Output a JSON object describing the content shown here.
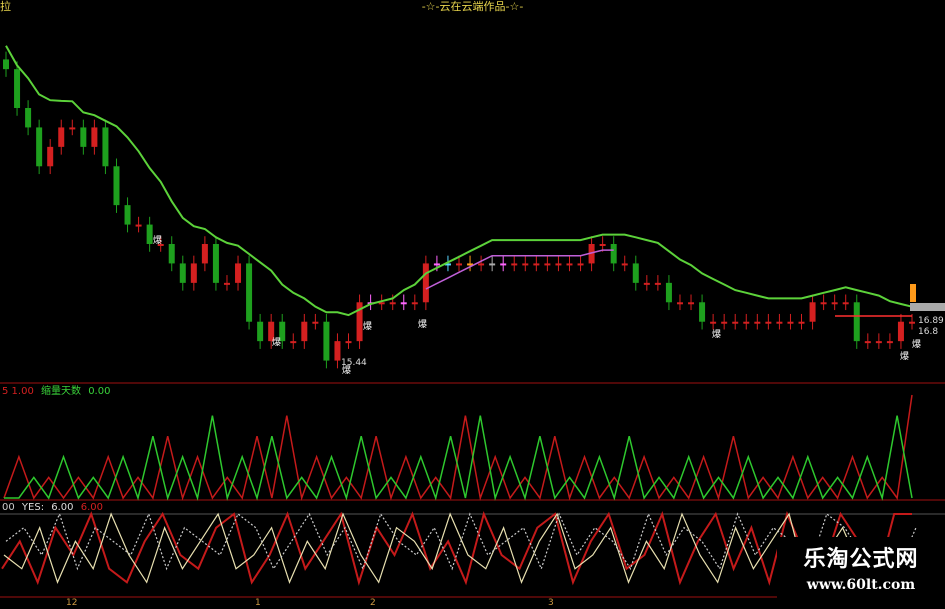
{
  "header": {
    "title": "-☆-云在云端作品-☆-",
    "corner_label": "拉"
  },
  "sub1": {
    "prefix": "5 1.00",
    "name": "缩量天数",
    "value": "0.00"
  },
  "sub2": {
    "prefix": "00",
    "name": "YES",
    "value": "6.00",
    "value2": "6.00"
  },
  "annotations": {
    "low_price": "15.44",
    "burst_label": "爆",
    "right_price": "16.89",
    "right_price2": "16.8"
  },
  "xaxis": {
    "ticks": [
      "12",
      "1",
      "2",
      "3"
    ]
  },
  "watermark": {
    "site_name": "乐淘公式网",
    "url": "www.60lt.com"
  },
  "colors": {
    "background": "#000000",
    "up_candle": "#d42020",
    "down_candle": "#1ea01e",
    "ma_line": "#5cd23a",
    "ma_line2": "#c060d8",
    "signal_pink": "#ff66ff",
    "signal_orange": "#ff9a1a",
    "signal_gray": "#aaaaaa",
    "signal_cyan": "#5ad8ff",
    "divider": "#a01010",
    "title": "#e8d44d"
  },
  "chart_data": [
    {
      "type": "candlestick",
      "title": "-☆-云在云端作品-☆-",
      "annotations": [
        "15.44",
        "16.89"
      ],
      "x_ticks": [
        "12",
        "1",
        "2",
        "3"
      ],
      "series": [
        {
          "name": "price",
          "close": [
            16.9,
            16.7,
            16.6,
            16.4,
            16.5,
            16.6,
            16.6,
            16.5,
            16.6,
            16.4,
            16.2,
            16.1,
            16.1,
            16.0,
            16.0,
            15.9,
            15.8,
            15.9,
            16.0,
            15.8,
            15.8,
            15.9,
            15.6,
            15.5,
            15.6,
            15.5,
            15.5,
            15.6,
            15.6,
            15.4,
            15.5,
            15.5,
            15.7,
            15.7,
            15.7,
            15.7,
            15.7,
            15.7,
            15.9,
            15.9,
            15.9,
            15.9,
            15.9,
            15.9,
            15.9,
            15.9,
            15.9,
            15.9,
            15.9,
            15.9,
            15.9,
            15.9,
            15.9,
            16.0,
            16.0,
            15.9,
            15.9,
            15.8,
            15.8,
            15.8,
            15.7,
            15.7,
            15.7,
            15.6,
            15.6,
            15.6,
            15.6,
            15.6,
            15.6,
            15.6,
            15.6,
            15.6,
            15.6,
            15.7,
            15.7,
            15.7,
            15.7,
            15.5,
            15.5,
            15.5,
            15.5,
            15.6,
            15.6
          ]
        }
      ]
    },
    {
      "type": "line",
      "name": "缩量天数",
      "series": [
        {
          "name": "red",
          "values": [
            0,
            2,
            0,
            1,
            0,
            1,
            0,
            2,
            0,
            1,
            0,
            3,
            0,
            2,
            0,
            1,
            0,
            3,
            0,
            4,
            0,
            2,
            0,
            1,
            0,
            3,
            0,
            2,
            0,
            1,
            0,
            4,
            0,
            2,
            0,
            1,
            0,
            3,
            0,
            2,
            0,
            1,
            0,
            2,
            0,
            1,
            0,
            2,
            0,
            3,
            0,
            1,
            0,
            2,
            0,
            1,
            0,
            2,
            0,
            1,
            0,
            5
          ]
        },
        {
          "name": "green",
          "values": [
            0,
            0,
            1,
            0,
            2,
            0,
            1,
            0,
            2,
            0,
            3,
            0,
            2,
            0,
            4,
            0,
            2,
            0,
            3,
            0,
            1,
            0,
            2,
            0,
            3,
            0,
            1,
            0,
            2,
            0,
            3,
            0,
            4,
            0,
            2,
            0,
            3,
            0,
            1,
            0,
            2,
            0,
            3,
            0,
            1,
            0,
            2,
            0,
            1,
            0,
            2,
            0,
            1,
            0,
            2,
            0,
            1,
            0,
            2,
            0,
            4,
            0
          ]
        }
      ]
    },
    {
      "type": "line",
      "name": "YES",
      "series": [
        {
          "name": "red",
          "values": [
            2,
            4,
            1,
            5,
            3,
            6,
            2,
            1,
            4,
            6,
            3,
            2,
            5,
            6,
            1,
            3,
            6,
            2,
            4,
            6,
            1,
            5,
            3,
            6,
            2,
            4,
            1,
            6,
            3,
            2,
            5,
            6,
            1,
            4,
            6,
            2,
            3,
            6,
            1,
            4,
            6,
            2,
            5,
            1,
            6,
            3,
            2,
            6,
            4,
            1,
            6,
            6
          ]
        },
        {
          "name": "white",
          "values": [
            3,
            2,
            5,
            1,
            4,
            2,
            6,
            3,
            1,
            5,
            2,
            4,
            6,
            2,
            3,
            5,
            1,
            4,
            2,
            6,
            3,
            1,
            5,
            4,
            2,
            6,
            3,
            2,
            5,
            1,
            4,
            6,
            2,
            3,
            5,
            1,
            4,
            2,
            6,
            3,
            1,
            5,
            2,
            4,
            6,
            1,
            3,
            5,
            2,
            4,
            1,
            3
          ]
        },
        {
          "name": "dotted",
          "values": [
            4,
            5,
            3,
            6,
            2,
            5,
            4,
            3,
            6,
            2,
            5,
            4,
            3,
            6,
            5,
            2,
            4,
            6,
            3,
            5,
            2,
            6,
            4,
            3,
            5,
            2,
            6,
            3,
            4,
            5,
            2,
            6,
            3,
            5,
            4,
            2,
            6,
            3,
            5,
            4,
            2,
            6,
            3,
            5,
            4,
            2,
            6,
            5,
            3,
            4,
            2,
            5
          ]
        }
      ]
    }
  ]
}
